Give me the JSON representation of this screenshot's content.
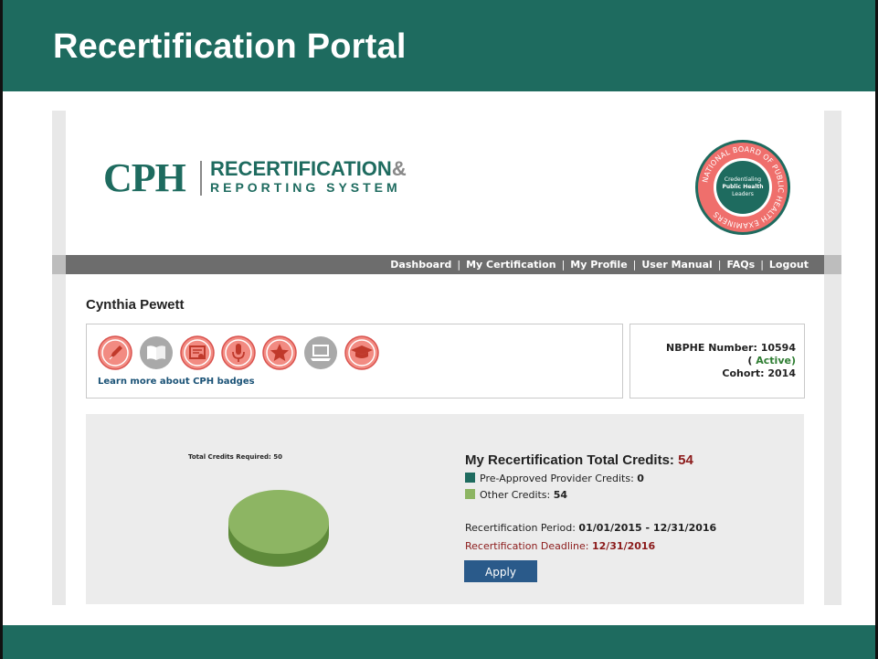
{
  "slide": {
    "title": "Recertification Portal"
  },
  "logo": {
    "mark": "CPH",
    "line1": "RECERTIFICATION",
    "ampersand": "&",
    "line2": "REPORTING SYSTEM"
  },
  "seal": {
    "outer_text": "NATIONAL BOARD OF PUBLIC HEALTH EXAMINERS",
    "inner_line1": "Credentialing",
    "inner_line2": "Public Health",
    "inner_line3": "Leaders"
  },
  "nav": {
    "items": [
      {
        "label": "Dashboard"
      },
      {
        "label": "My Certification"
      },
      {
        "label": "My Profile"
      },
      {
        "label": "User Manual"
      },
      {
        "label": "FAQs"
      },
      {
        "label": "Logout"
      }
    ],
    "separator": "|"
  },
  "user": {
    "name": "Cynthia Pewett"
  },
  "badges": {
    "items": [
      {
        "icon": "pen-icon",
        "earned": true
      },
      {
        "icon": "book-icon",
        "earned": false
      },
      {
        "icon": "certificate-icon",
        "earned": true
      },
      {
        "icon": "microphone-icon",
        "earned": true
      },
      {
        "icon": "star-icon",
        "earned": true
      },
      {
        "icon": "laptop-icon",
        "earned": false
      },
      {
        "icon": "graduation-cap-icon",
        "earned": true
      }
    ],
    "link_label": "Learn more about CPH badges"
  },
  "identity": {
    "number_label": "NBPHE Number:",
    "number_value": "10594",
    "status_open": "(",
    "status_value": "Active",
    "status_close": ")",
    "cohort_label": "Cohort:",
    "cohort_value": "2014"
  },
  "credits": {
    "pie_label": "Total Credits Required: 50",
    "title_label": "My Recertification Total Credits:",
    "total": "54",
    "legend": [
      {
        "label": "Pre-Approved Provider Credits:",
        "value": "0",
        "color": "#1e6b5f"
      },
      {
        "label": "Other Credits:",
        "value": "54",
        "color": "#8db563"
      }
    ],
    "period_label": "Recertification Period:",
    "period_value": "01/01/2015 - 12/31/2016",
    "deadline_label": "Recertification Deadline:",
    "deadline_value": "12/31/2016",
    "apply_label": "Apply"
  },
  "colors": {
    "brand_green": "#1e6b5f",
    "badge_earned": "#f28b82",
    "badge_unearned": "#a9a9a9",
    "pie_green": "#8db563",
    "button_blue": "#2a5a8a",
    "alert_red": "#8b1a1a"
  }
}
